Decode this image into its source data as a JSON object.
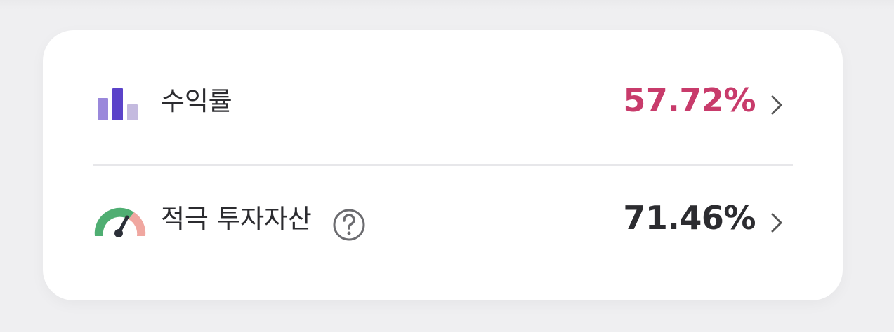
{
  "colors": {
    "background": "#efeff1",
    "card": "#ffffff",
    "divider": "#e7e7ea",
    "primary_text": "#2b2b2f",
    "return_value": "#c83b6b",
    "neutral_value": "#2c2c30",
    "bar_dark": "#5b43c9",
    "bar_mid": "#9a88db",
    "bar_light": "#c4badf",
    "gauge_green": "#4fae72",
    "gauge_red": "#f0a7a0",
    "gauge_needle": "#2b2f38"
  },
  "rows": [
    {
      "icon": "bar-chart-icon",
      "label": "수익률",
      "value": "57.72%"
    },
    {
      "icon": "gauge-icon",
      "label": "적극 투자자산",
      "value": "71.46%",
      "help_icon": "question-circle-icon"
    }
  ]
}
